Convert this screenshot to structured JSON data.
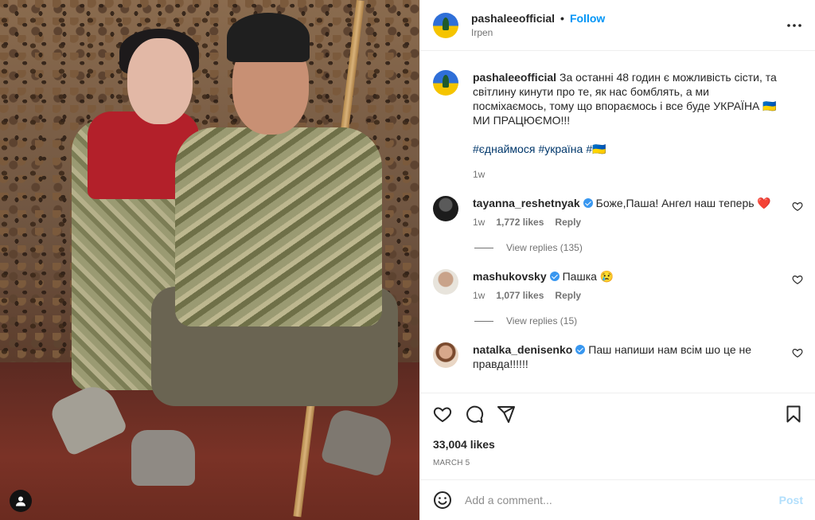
{
  "post": {
    "author": "pashaleeofficial",
    "separator": "•",
    "follow_label": "Follow",
    "location": "Irpen",
    "caption_text": "За останні 48 годин є можливість сісти, та світлину кинути про те, як нас бомблять, а ми посміхаємось, тому що впораємось і все буде УКРАЇНА 🇺🇦 МИ ПРАЦЮЄМО!!!",
    "hashtags": [
      "#єднаймося",
      "#україна",
      "#🇺🇦"
    ],
    "caption_age": "1w",
    "likes": "33,004 likes",
    "date": "March 5"
  },
  "comments": [
    {
      "username": "tayanna_reshetnyak",
      "text": "Боже,Паша! Ангел наш теперь",
      "emoji": "❤️",
      "age": "1w",
      "likes": "1,772 likes",
      "reply_label": "Reply",
      "view_replies": "View replies (135)"
    },
    {
      "username": "mashukovsky",
      "text": "Пашка",
      "emoji": "😢",
      "age": "1w",
      "likes": "1,077 likes",
      "reply_label": "Reply",
      "view_replies": "View replies (15)"
    },
    {
      "username": "natalka_denisenko",
      "text": "Паш напиши нам всім шо це не правда!!!!!!"
    }
  ],
  "composer": {
    "placeholder": "Add a comment...",
    "post_label": "Post"
  },
  "icons": {
    "more": "more-options-icon",
    "like": "heart-icon",
    "comment": "comment-icon",
    "share": "paper-plane-icon",
    "save": "bookmark-icon",
    "emoji": "smiley-icon",
    "tagged_user": "user-icon",
    "verified": "verified-badge-icon"
  },
  "colors": {
    "link": "#0095f6",
    "hashtag": "#00376b",
    "verified": "#3897f0",
    "post_disabled": "#b2dffc",
    "secondary_text": "#737373"
  }
}
